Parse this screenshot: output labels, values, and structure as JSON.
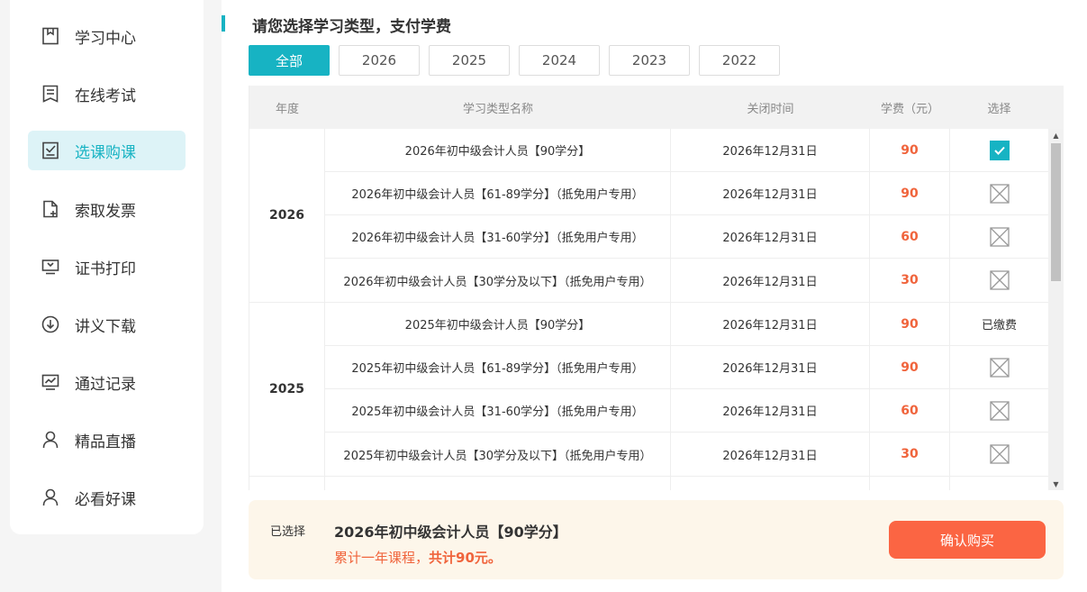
{
  "sidebar": {
    "items": [
      {
        "label": "学习中心",
        "icon": "bookmark-icon"
      },
      {
        "label": "在线考试",
        "icon": "exam-icon"
      },
      {
        "label": "选课购课",
        "icon": "checkbox-icon",
        "active": true
      },
      {
        "label": "索取发票",
        "icon": "invoice-icon"
      },
      {
        "label": "证书打印",
        "icon": "monitor-icon"
      },
      {
        "label": "讲义下载",
        "icon": "download-icon"
      },
      {
        "label": "通过记录",
        "icon": "chart-icon"
      },
      {
        "label": "精品直播",
        "icon": "user-icon"
      },
      {
        "label": "必看好课",
        "icon": "user-icon"
      }
    ]
  },
  "main": {
    "title": "请您选择学习类型，支付学费",
    "tabs": [
      "全部",
      "2026",
      "2025",
      "2024",
      "2023",
      "2022"
    ],
    "columns": [
      "年度",
      "学习类型名称",
      "关闭时间",
      "学费（元）",
      "选择"
    ],
    "groups": [
      {
        "year": "2026",
        "rows": [
          {
            "name": "2026年初中级会计人员【90学分】",
            "close": "2026年12月31日",
            "fee": "90",
            "state": "checked"
          },
          {
            "name": "2026年初中级会计人员【61-89学分】（抵免用户专用）",
            "close": "2026年12月31日",
            "fee": "90",
            "state": "disabled"
          },
          {
            "name": "2026年初中级会计人员【31-60学分】（抵免用户专用）",
            "close": "2026年12月31日",
            "fee": "60",
            "state": "disabled"
          },
          {
            "name": "2026年初中级会计人员【30学分及以下】（抵免用户专用）",
            "close": "2026年12月31日",
            "fee": "30",
            "state": "disabled"
          }
        ]
      },
      {
        "year": "2025",
        "rows": [
          {
            "name": "2025年初中级会计人员【90学分】",
            "close": "2026年12月31日",
            "fee": "90",
            "state": "paid",
            "state_text": "已缴费"
          },
          {
            "name": "2025年初中级会计人员【61-89学分】（抵免用户专用）",
            "close": "2026年12月31日",
            "fee": "90",
            "state": "disabled"
          },
          {
            "name": "2025年初中级会计人员【31-60学分】（抵免用户专用）",
            "close": "2026年12月31日",
            "fee": "60",
            "state": "disabled"
          },
          {
            "name": "2025年初中级会计人员【30学分及以下】（抵免用户专用）",
            "close": "2026年12月31日",
            "fee": "30",
            "state": "disabled"
          }
        ]
      }
    ]
  },
  "footer": {
    "selected_label": "已选择",
    "selected_name": "2026年初中级会计人员【90学分】",
    "desc_prefix": "累计一年课程，",
    "desc_total": "共计90元。",
    "buy_label": "确认购买"
  },
  "colors": {
    "accent": "#17b3c3",
    "price": "#f0643c",
    "buy": "#fb6543"
  }
}
